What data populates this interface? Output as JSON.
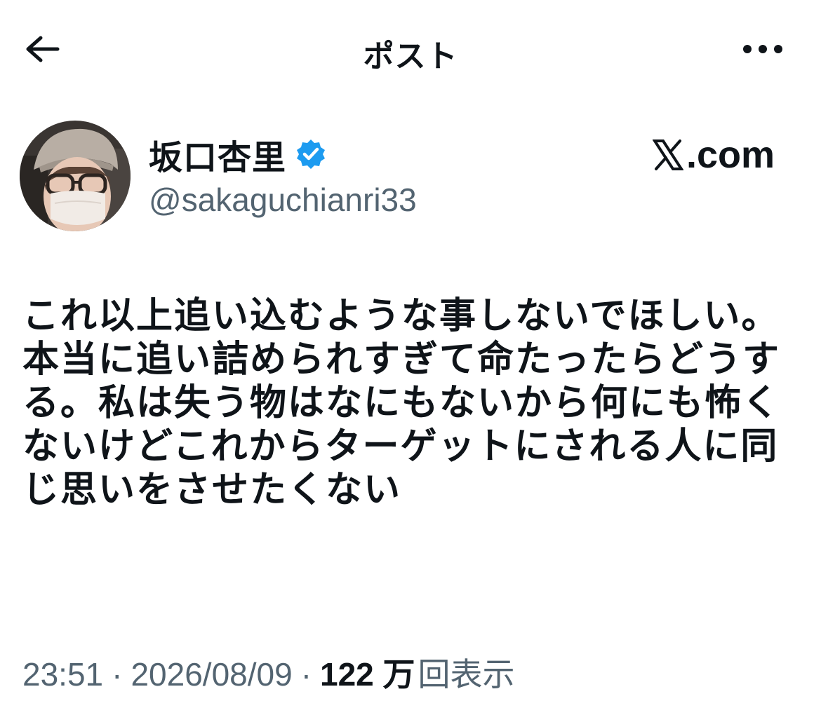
{
  "header": {
    "title": "ポスト",
    "back_icon": "arrow-left-icon",
    "more_icon": "more-horizontal-icon"
  },
  "author": {
    "display_name": "坂口杏里",
    "handle": "@sakaguchianri33",
    "verified_icon": "verified-badge-icon",
    "verified_color": "#1d9bf0"
  },
  "brand": {
    "logo_icon": "x-logo-icon",
    "domain_suffix": ".com"
  },
  "post": {
    "text": "これ以上追い込むような事しないでほしい。本当に追い詰められすぎて命たったらどうする。私は失う物はなにもないから何にも怖くないけどこれからターゲットにされる人に同じ思いをさせたくない"
  },
  "meta": {
    "time": "23:51",
    "separator": "·",
    "date": "2026/08/09",
    "views_count": "122 万",
    "views_label": "回表示"
  },
  "colors": {
    "text_primary": "#0f1419",
    "text_secondary": "#536471",
    "accent": "#1d9bf0",
    "background": "#ffffff"
  }
}
